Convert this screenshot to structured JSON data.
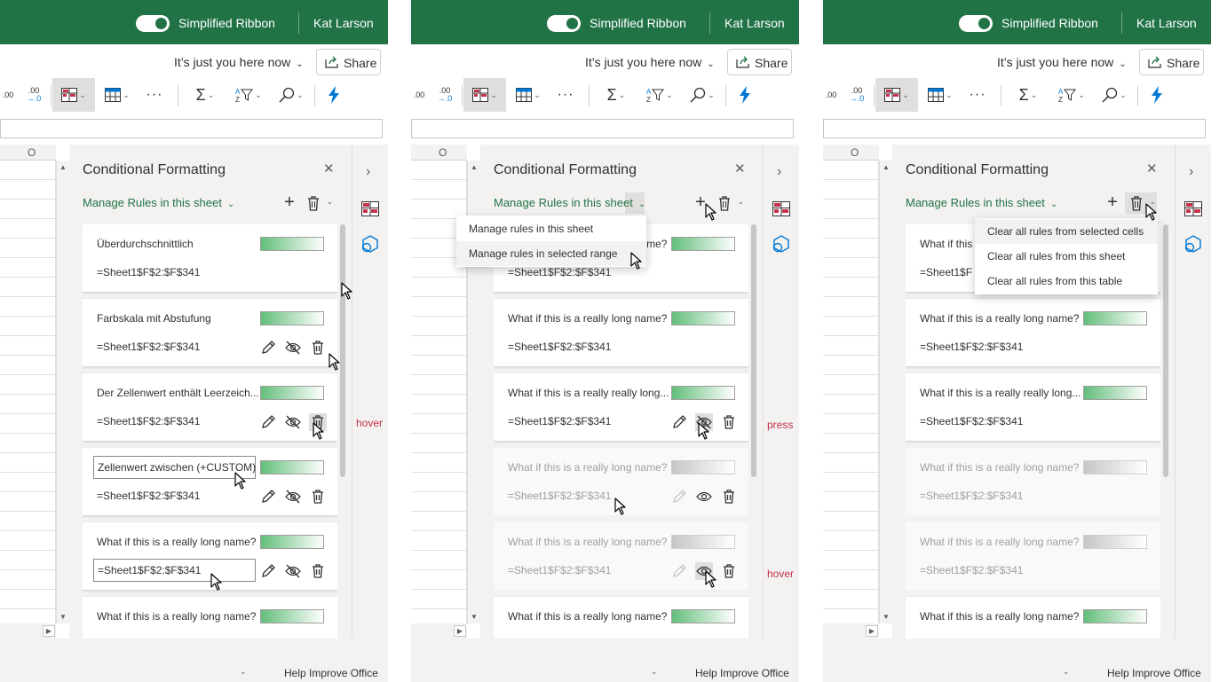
{
  "colors": {
    "brand": "#217346",
    "accent_green": "#217346",
    "state_label": "#c4314b",
    "gradient_start": "#63be7b"
  },
  "titlebar": {
    "simplified_ribbon": "Simplified Ribbon",
    "user": "Kat Larson"
  },
  "tellme": {
    "text": "It’s just you here now"
  },
  "share": {
    "label": "Share"
  },
  "ribbon": {
    "icons": [
      "decrease-decimal-icon",
      "conditional-formatting-icon",
      "format-as-table-icon",
      "more-icon",
      "autosum-icon",
      "sort-filter-icon",
      "find-icon",
      "ideas-icon"
    ]
  },
  "sheet": {
    "column_header": "O"
  },
  "pane": {
    "title": "Conditional Formatting",
    "manage_label": "Manage Rules in this sheet"
  },
  "status": {
    "help": "Help Improve Office"
  },
  "panels": [
    {
      "state_label": "hover",
      "rules": [
        {
          "name": "Überdurchschnittlich",
          "range": "=Sheet1$F$2:$F$341",
          "disabled": false
        },
        {
          "name": "Farbskala mit Abstufung",
          "range": "=Sheet1$F$2:$F$341",
          "disabled": false
        },
        {
          "name": "Der Zellenwert enthält Leerzeich...",
          "range": "=Sheet1$F$2:$F$341",
          "disabled": false
        },
        {
          "name": "Zellenwert zwischen (+CUSTOM)",
          "range": "=Sheet1$F$2:$F$341",
          "disabled": false
        },
        {
          "name": "What if this is a really long name?",
          "range": "=Sheet1$F$2:$F$341",
          "disabled": false
        },
        {
          "name": "What if this is a really long name?",
          "range": "",
          "disabled": false
        }
      ]
    },
    {
      "state_labels": [
        "press",
        "hover"
      ],
      "menu": [
        "Manage rules in this sheet",
        "Manage rules in selected range"
      ],
      "rules": [
        {
          "name": "What if this is a really long name?",
          "range": "=Sheet1$F$2:$F$341",
          "disabled": false
        },
        {
          "name": "What if this is a really long name?",
          "range": "=Sheet1$F$2:$F$341",
          "disabled": false
        },
        {
          "name": "What if this is a really really long...",
          "range": "=Sheet1$F$2:$F$341",
          "disabled": false
        },
        {
          "name": "What if this is a really long name?",
          "range": "=Sheet1$F$2:$F$341",
          "disabled": true
        },
        {
          "name": "What if this is a really long name?",
          "range": "=Sheet1$F$2:$F$341",
          "disabled": true
        },
        {
          "name": "What if this is a really long name?",
          "range": "",
          "disabled": false
        }
      ]
    },
    {
      "menu": [
        "Clear all rules from selected cells",
        "Clear all rules from this sheet",
        "Clear all rules from this table"
      ],
      "rules": [
        {
          "name": "What if this",
          "range": "=Sheet1$F",
          "disabled": false
        },
        {
          "name": "What if this is a really long name?",
          "range": "=Sheet1$F$2:$F$341",
          "disabled": false
        },
        {
          "name": "What if this is a really really long...",
          "range": "=Sheet1$F$2:$F$341",
          "disabled": false
        },
        {
          "name": "What if this is a really long name?",
          "range": "=Sheet1$F$2:$F$341",
          "disabled": true
        },
        {
          "name": "What if this is a really long name?",
          "range": "=Sheet1$F$2:$F$341",
          "disabled": true
        },
        {
          "name": "What if this is a really long name?",
          "range": "",
          "disabled": false
        }
      ]
    }
  ]
}
